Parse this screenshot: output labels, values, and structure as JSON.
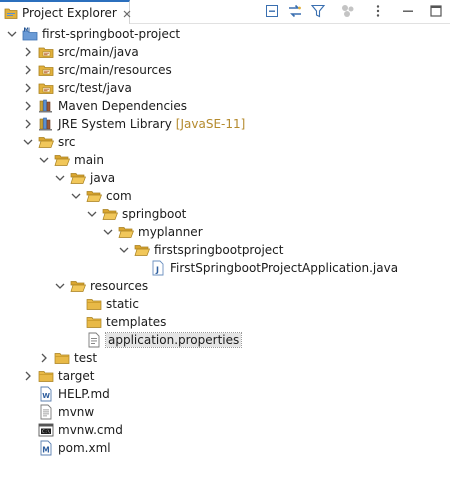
{
  "view": {
    "title": "Project Explorer"
  },
  "tree": [
    {
      "label": "first-springboot-project",
      "icon": "maven-project-icon",
      "twisty": "expanded"
    },
    {
      "label": "src/main/java",
      "icon": "source-folder-icon",
      "twisty": "collapsed"
    },
    {
      "label": "src/main/resources",
      "icon": "source-folder-icon",
      "twisty": "collapsed"
    },
    {
      "label": "src/test/java",
      "icon": "source-folder-icon",
      "twisty": "collapsed"
    },
    {
      "label": "Maven Dependencies",
      "icon": "library-icon",
      "twisty": "collapsed"
    },
    {
      "label": "JRE System Library",
      "decoration": "[JavaSE-11]",
      "icon": "library-icon",
      "twisty": "collapsed"
    },
    {
      "label": "src",
      "icon": "folder-open-icon",
      "twisty": "expanded"
    },
    {
      "label": "main",
      "icon": "folder-open-icon",
      "twisty": "expanded"
    },
    {
      "label": "java",
      "icon": "folder-open-icon",
      "twisty": "expanded"
    },
    {
      "label": "com",
      "icon": "folder-open-icon",
      "twisty": "expanded"
    },
    {
      "label": "springboot",
      "icon": "folder-open-icon",
      "twisty": "expanded"
    },
    {
      "label": "myplanner",
      "icon": "folder-open-icon",
      "twisty": "expanded"
    },
    {
      "label": "firstspringbootproject",
      "icon": "folder-open-icon",
      "twisty": "expanded"
    },
    {
      "label": "FirstSpringbootProjectApplication.java",
      "icon": "java-file-icon",
      "twisty": "none"
    },
    {
      "label": "resources",
      "icon": "folder-open-icon",
      "twisty": "expanded"
    },
    {
      "label": "static",
      "icon": "folder-icon",
      "twisty": "none"
    },
    {
      "label": "templates",
      "icon": "folder-icon",
      "twisty": "none"
    },
    {
      "label": "application.properties",
      "icon": "properties-file-icon",
      "twisty": "none",
      "selected": true
    },
    {
      "label": "test",
      "icon": "folder-icon",
      "twisty": "collapsed"
    },
    {
      "label": "target",
      "icon": "folder-icon",
      "twisty": "collapsed"
    },
    {
      "label": "HELP.md",
      "icon": "markdown-file-icon",
      "twisty": "none"
    },
    {
      "label": "mvnw",
      "icon": "text-file-icon",
      "twisty": "none"
    },
    {
      "label": "mvnw.cmd",
      "icon": "cmd-file-icon",
      "twisty": "none"
    },
    {
      "label": "pom.xml",
      "icon": "maven-pom-icon",
      "twisty": "none"
    }
  ],
  "colors": {
    "tree_decoration": "#b48a2d",
    "folder": "#e2b13c",
    "selection": "#e5e5e5",
    "active_tab_border": "#2b6fbd"
  }
}
